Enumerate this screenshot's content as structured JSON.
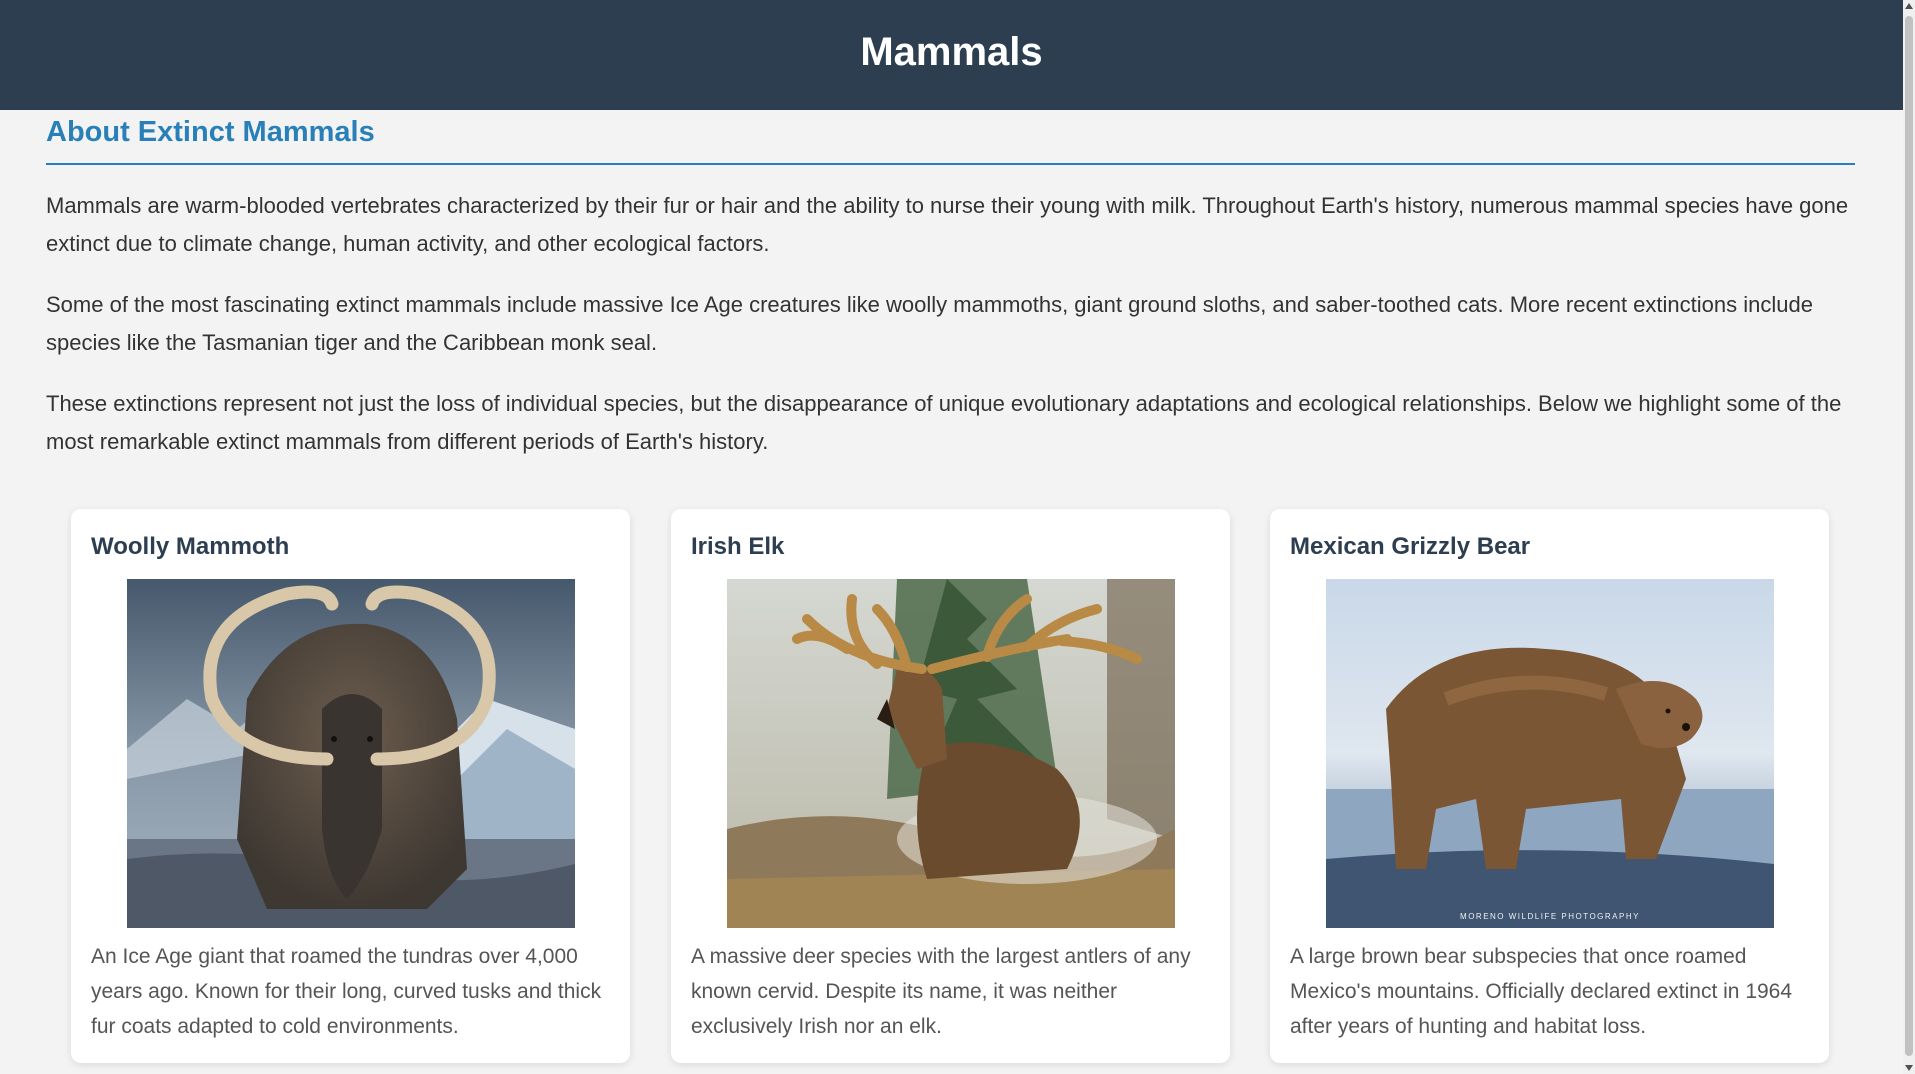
{
  "header": {
    "title": "Mammals"
  },
  "about": {
    "title": "About Extinct Mammals",
    "paragraphs": [
      "Mammals are warm-blooded vertebrates characterized by their fur or hair and the ability to nurse their young with milk. Throughout Earth's history, numerous mammal species have gone extinct due to climate change, human activity, and other ecological factors.",
      "Some of the most fascinating extinct mammals include massive Ice Age creatures like woolly mammoths, giant ground sloths, and saber-toothed cats. More recent extinctions include species like the Tasmanian tiger and the Caribbean monk seal.",
      "These extinctions represent not just the loss of individual species, but the disappearance of unique evolutionary adaptations and ecological relationships. Below we highlight some of the most remarkable extinct mammals from different periods of Earth's history."
    ]
  },
  "cards": [
    {
      "title": "Woolly Mammoth",
      "description": "An Ice Age giant that roamed the tundras over 4,000 years ago. Known for their long, curved tusks and thick fur coats adapted to cold environments."
    },
    {
      "title": "Irish Elk",
      "description": "A massive deer species with the largest antlers of any known cervid. Despite its name, it was neither exclusively Irish nor an elk."
    },
    {
      "title": "Mexican Grizzly Bear",
      "description": "A large brown bear subspecies that once roamed Mexico's mountains. Officially declared extinct in 1964 after years of hunting and habitat loss.",
      "photo_watermark": "MORENO WILDLIFE PHOTOGRAPHY"
    }
  ]
}
